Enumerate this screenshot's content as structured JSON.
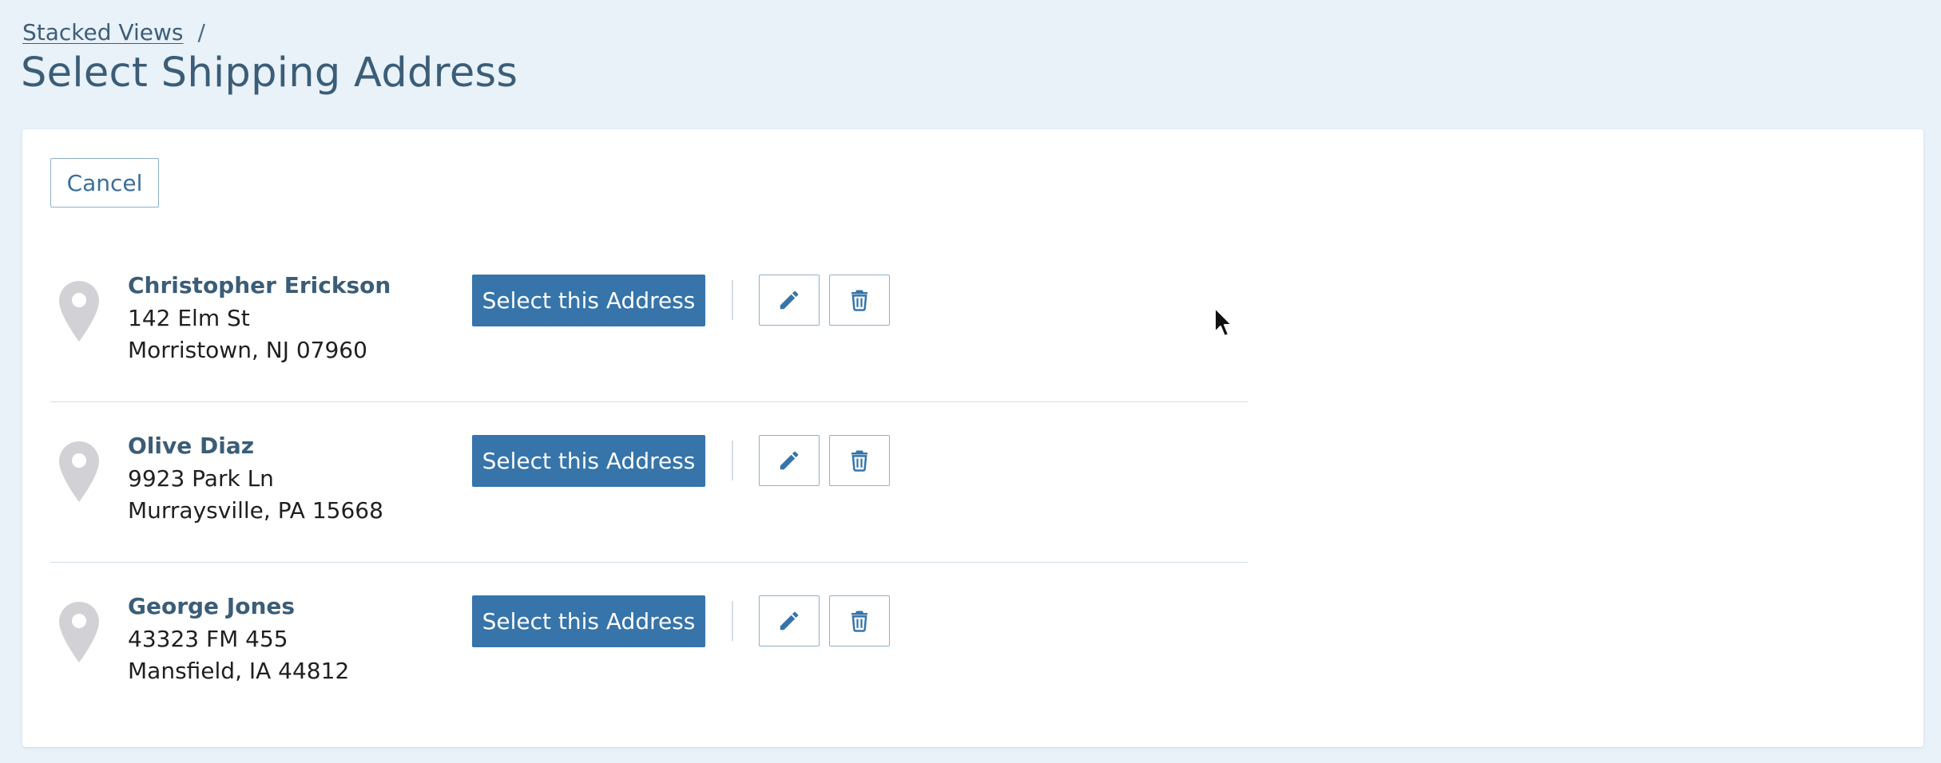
{
  "breadcrumb": {
    "link_label": "Stacked Views",
    "separator": "/"
  },
  "page": {
    "title": "Select Shipping Address"
  },
  "actions": {
    "cancel_label": "Cancel"
  },
  "addresses": [
    {
      "name": "Christopher Erickson",
      "street": "142 Elm St",
      "city_state_zip": "Morristown, NJ 07960",
      "select_label": "Select this Address"
    },
    {
      "name": "Olive Diaz",
      "street": "9923 Park Ln",
      "city_state_zip": "Murraysville, PA 15668",
      "select_label": "Select this Address"
    },
    {
      "name": "George Jones",
      "street": "43323 FM 455",
      "city_state_zip": "Mansfield, IA 44812",
      "select_label": "Select this Address"
    }
  ],
  "icons": {
    "pin": "map-pin-icon",
    "edit": "pencil-icon",
    "delete": "trash-icon"
  },
  "colors": {
    "page_background": "#e9f1f9",
    "primary": "#3674a9",
    "heading": "#3b5d77",
    "pin": "#d2d2d6"
  }
}
